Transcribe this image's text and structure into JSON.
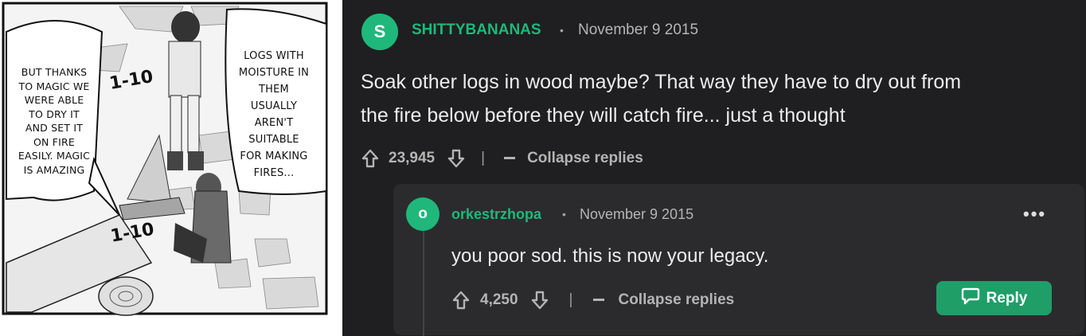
{
  "manga": {
    "left_bubble": [
      "BUT THANKS",
      "TO MAGIC WE",
      "WERE ABLE",
      "TO DRY IT",
      "AND SET IT",
      "ON FIRE",
      "EASILY. MAGIC",
      "IS AMAZING"
    ],
    "right_bubble": [
      "LOGS WITH",
      "MOISTURE IN",
      "THEM",
      "USUALLY",
      "AREN'T",
      "SUITABLE",
      "FOR MAKING",
      "FIRES..."
    ],
    "sfx_top": "1-10",
    "sfx_bottom": "1-10"
  },
  "comment": {
    "avatar_letter": "S",
    "username": "SHITTYBANANAS",
    "separator": "•",
    "date": "November 9 2015",
    "text_line1": "Soak other logs in wood maybe? That way they have to dry out from",
    "text_line2": "the fire below before they will catch fire... just a thought",
    "upvotes": "23,945",
    "divider": "|",
    "collapse_label": "Collapse replies"
  },
  "reply": {
    "avatar_letter": "o",
    "username": "orkestrzhopa",
    "separator": "•",
    "date": "November 9 2015",
    "more": "•••",
    "text": "you poor sod. this is now your legacy.",
    "upvotes": "4,250",
    "divider": "|",
    "collapse_label": "Collapse replies",
    "reply_label": "Reply"
  },
  "colors": {
    "background": "#1f1f21",
    "card": "#2b2b2e",
    "accent": "#1fb87a",
    "reply_button": "#1f9e68"
  },
  "icons": [
    "upvote-arrow-icon",
    "downvote-arrow-icon",
    "minus-icon",
    "chat-bubble-icon",
    "more-options-icon"
  ]
}
